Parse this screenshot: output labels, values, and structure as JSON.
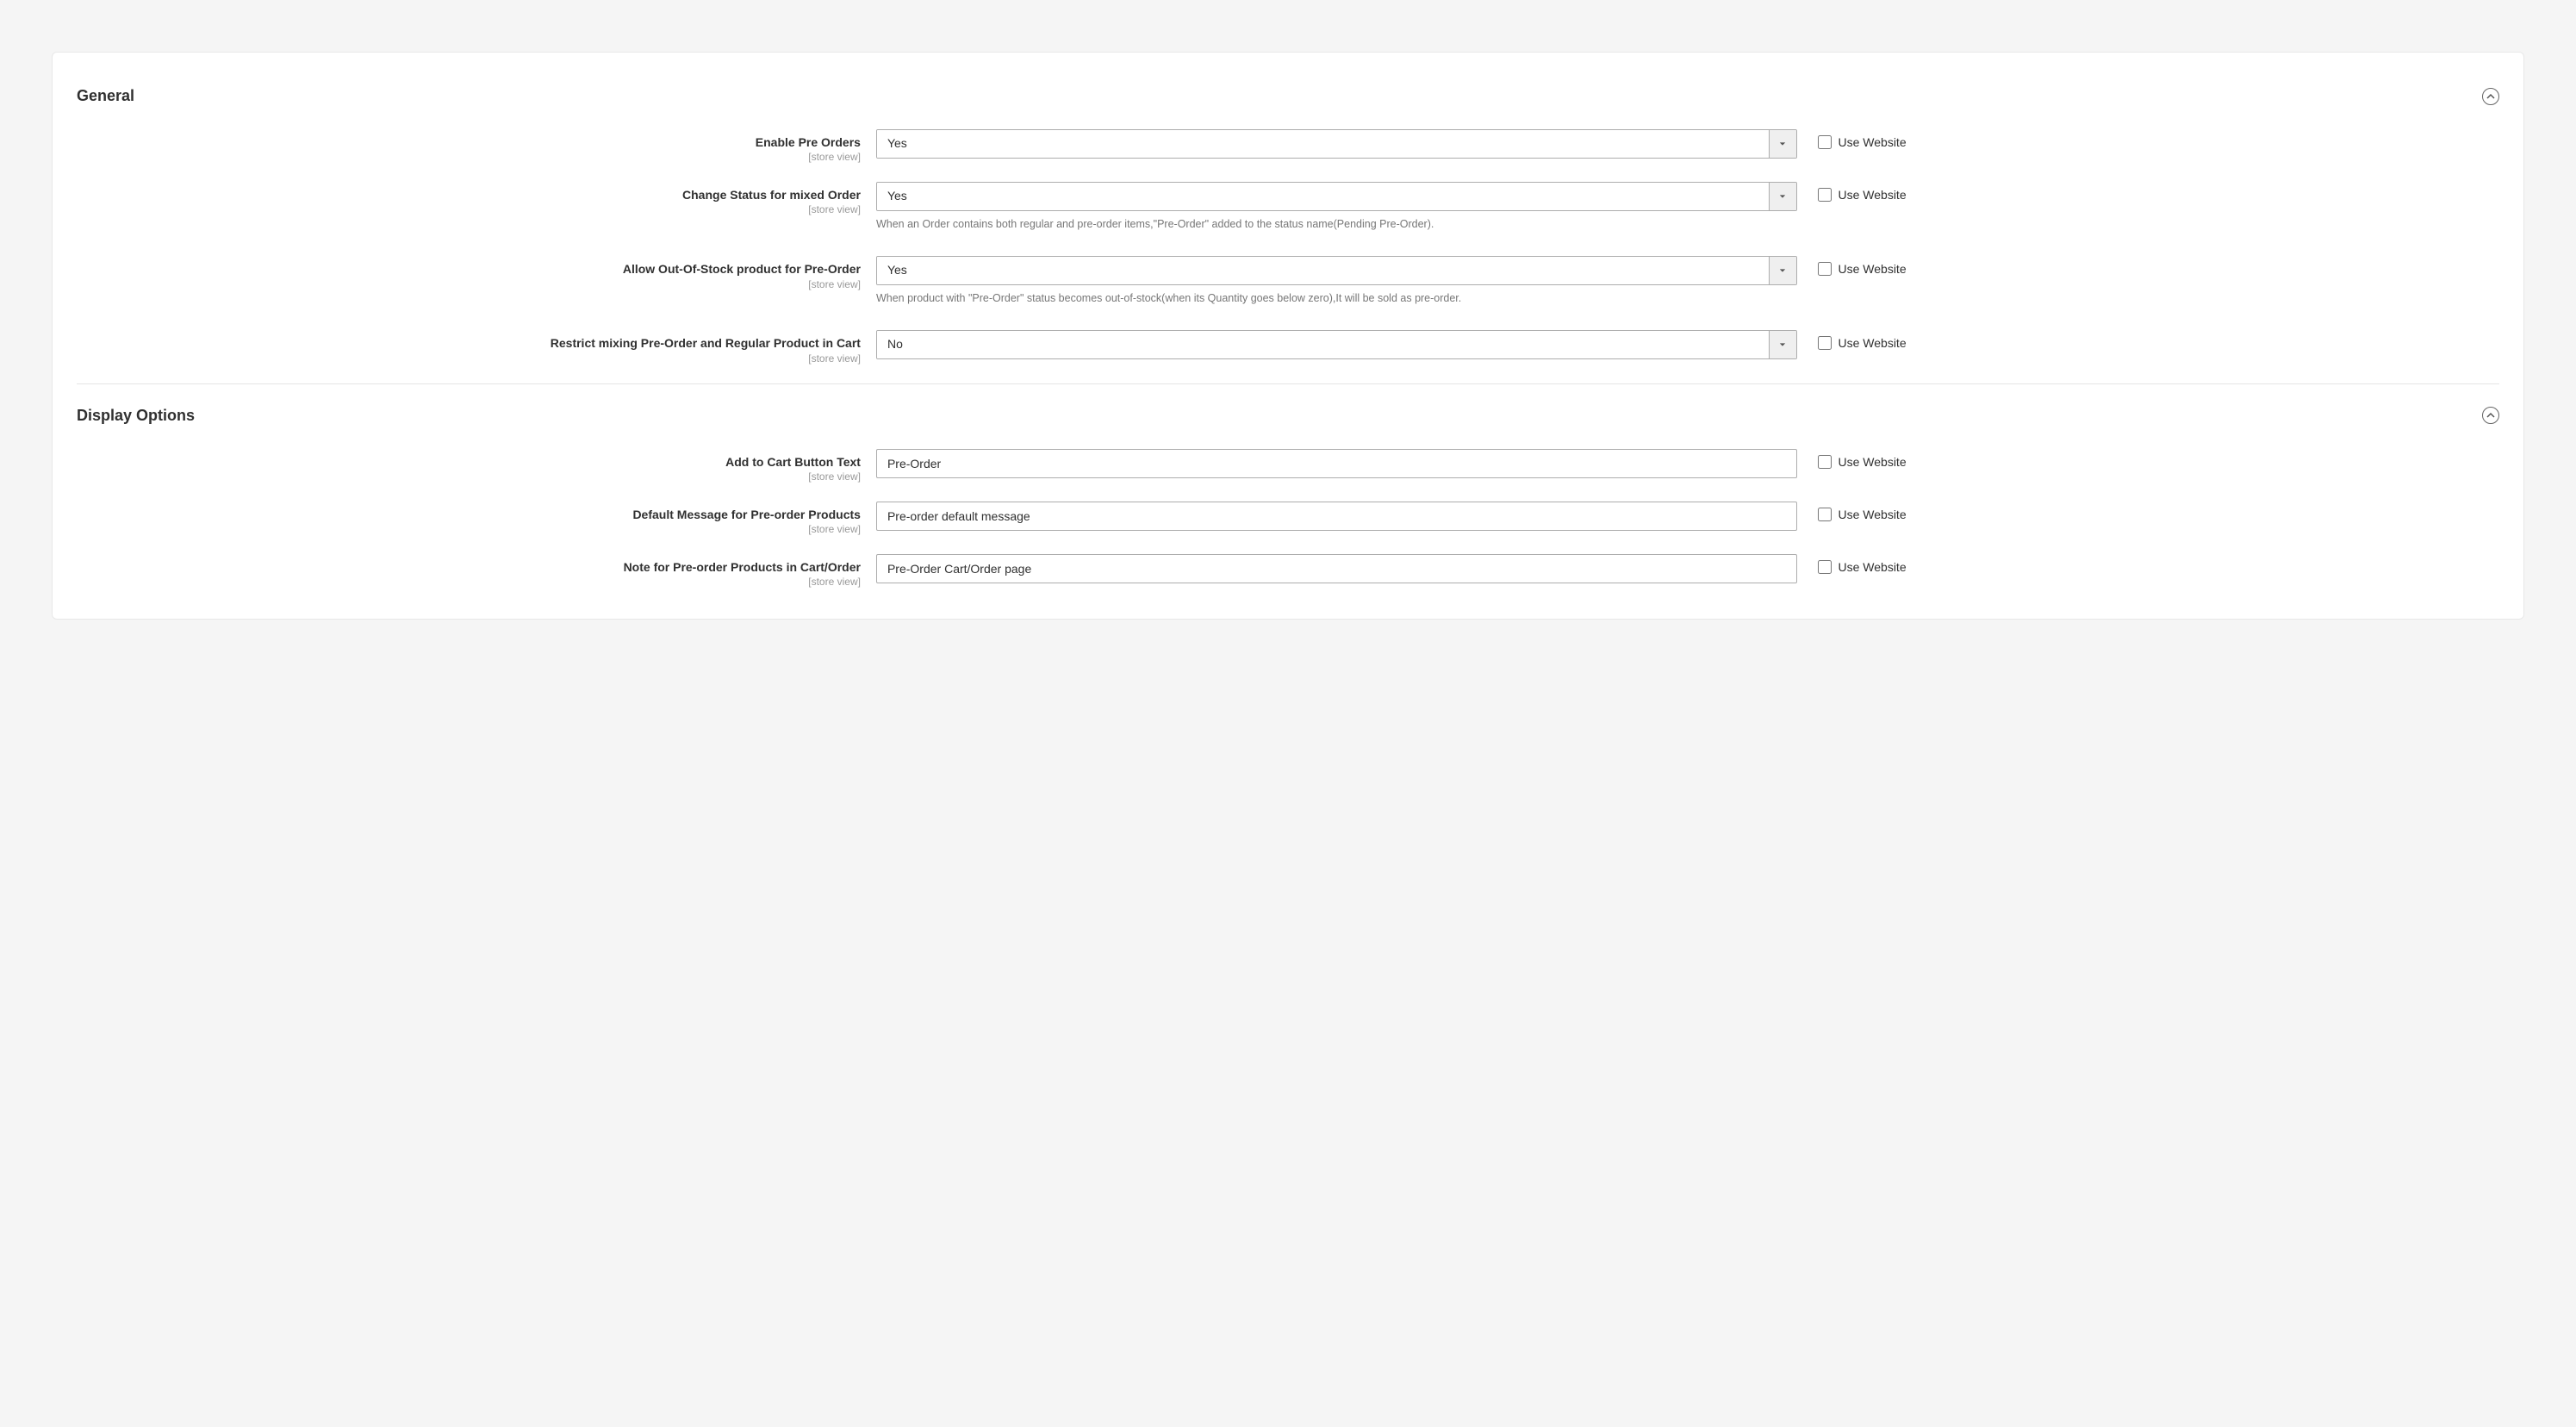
{
  "scope_label": "[store view]",
  "use_website_label": "Use Website",
  "sections": {
    "general": {
      "title": "General",
      "fields": {
        "enable": {
          "label": "Enable Pre Orders",
          "value": "Yes"
        },
        "change_status": {
          "label": "Change Status for mixed Order",
          "value": "Yes",
          "hint": "When an Order contains both regular and pre-order items,\"Pre-Order\" added to the status name(Pending Pre-Order)."
        },
        "allow_oos": {
          "label": "Allow Out-Of-Stock product for Pre-Order",
          "value": "Yes",
          "hint": "When product with \"Pre-Order\" status becomes out-of-stock(when its Quantity goes below zero),It will be sold as pre-order."
        },
        "restrict_mix": {
          "label": "Restrict mixing Pre-Order and Regular Product in Cart",
          "value": "No"
        }
      }
    },
    "display": {
      "title": "Display Options",
      "fields": {
        "btn_text": {
          "label": "Add to Cart Button Text",
          "value": "Pre-Order"
        },
        "default_msg": {
          "label": "Default Message for Pre-order Products",
          "value": "Pre-order default message"
        },
        "cart_note": {
          "label": "Note for Pre-order Products in Cart/Order",
          "value": "Pre-Order Cart/Order page"
        }
      }
    }
  }
}
